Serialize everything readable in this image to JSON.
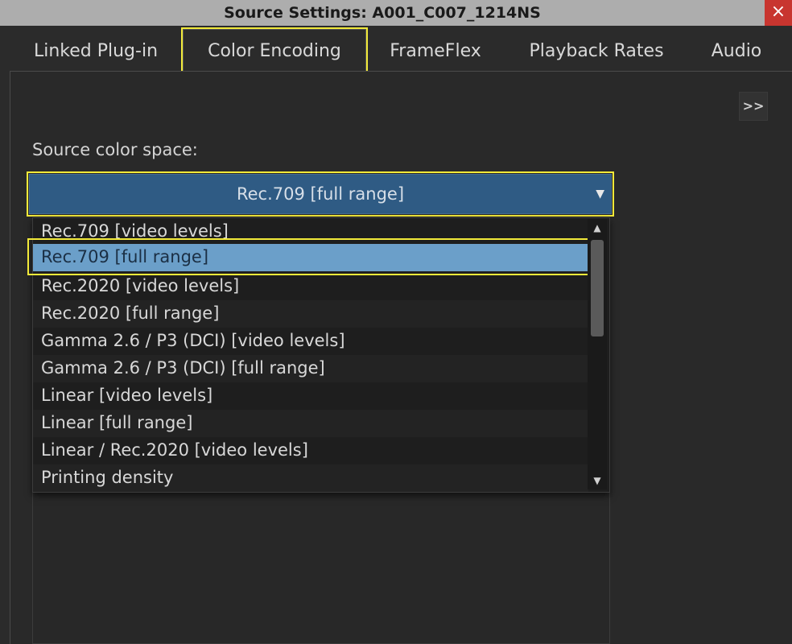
{
  "window": {
    "title": "Source Settings: A001_C007_1214NS",
    "close_icon": "×"
  },
  "tabs": [
    {
      "label": "Linked Plug-in"
    },
    {
      "label": "Color Encoding"
    },
    {
      "label": "FrameFlex"
    },
    {
      "label": "Playback Rates"
    },
    {
      "label": "Audio"
    }
  ],
  "active_tab": "Color Encoding",
  "panel": {
    "more_button": ">>",
    "source_color_space_label": "Source color space:",
    "source_color_space_value": "Rec.709 [full range]",
    "dropdown_arrow": "▼"
  },
  "dropdown": {
    "options": [
      "Rec.709 [video levels]",
      "Rec.709 [full range]",
      "Rec.2020 [video levels]",
      "Rec.2020 [full range]",
      "Gamma 2.6 / P3 (DCI) [video levels]",
      "Gamma 2.6 / P3 (DCI) [full range]",
      "Linear [video levels]",
      "Linear [full range]",
      "Linear / Rec.2020 [video levels]",
      "Printing density"
    ],
    "selected": "Rec.709 [full range]",
    "scroll_up": "▲",
    "scroll_down": "▼"
  },
  "colors": {
    "highlight": "#f2ea3a",
    "combo_bg": "#2f5b84",
    "selected_bg": "#6b9fc9",
    "close_bg": "#c8352f"
  }
}
